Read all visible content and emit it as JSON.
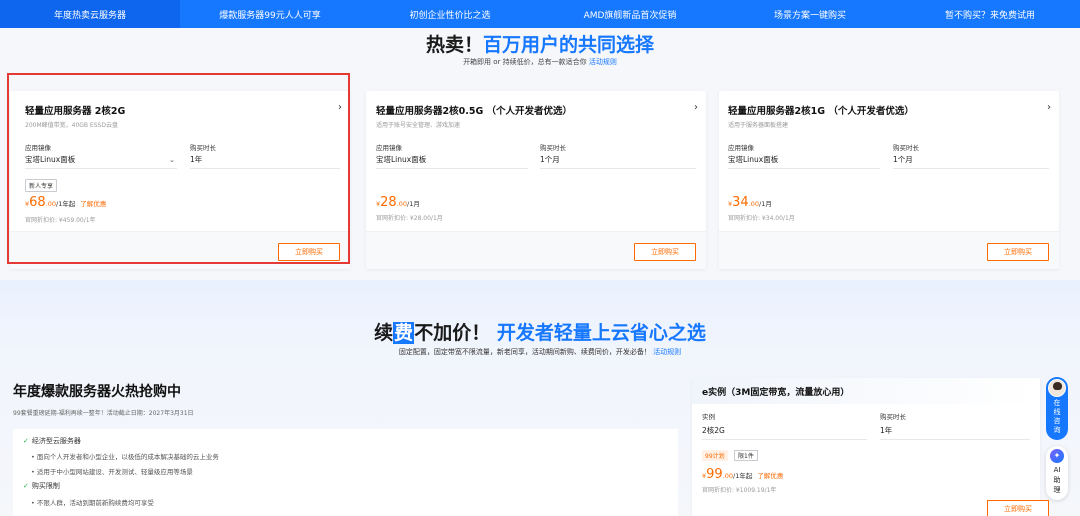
{
  "tabs": [
    "年度热卖云服务器",
    "爆款服务器99元人人可享",
    "初创企业性价比之选",
    "AMD旗舰新品首次促销",
    "场景方案一键购买",
    "暂不购买？来免费试用"
  ],
  "section1": {
    "title_a": "热卖！",
    "title_b": "百万用户的共同选择",
    "subtitle": "开箱即用 or 持续低价，总有一款适合你",
    "rules_link": "活动规则"
  },
  "cards": [
    {
      "title": "轻量应用服务器 2核2G",
      "desc": "200M峰值带宽，40GB ESSD云盘",
      "image_label": "应用镜像",
      "image_value": "宝塔Linux面板",
      "duration_label": "购买时长",
      "duration_value": "1年",
      "badge": "新人专享",
      "currency": "¥",
      "price": "68",
      "price_decimal": ".00",
      "price_unit": "/1年起",
      "promo": "了解优惠",
      "orig": "官网折扣价: ¥459.00/1年",
      "buy": "立即购买"
    },
    {
      "title": "轻量应用服务器2核0.5G （个人开发者优选）",
      "desc": "适用于账号安全管理、游戏加速",
      "image_label": "应用镜像",
      "image_value": "宝塔Linux面板",
      "duration_label": "购买时长",
      "duration_value": "1个月",
      "currency": "¥",
      "price": "28",
      "price_decimal": ".00",
      "price_unit": "/1月",
      "orig": "官网折扣价: ¥28.00/1月",
      "buy": "立即购买"
    },
    {
      "title": "轻量应用服务器2核1G （个人开发者优选）",
      "desc": "适用于服务器面板搭建",
      "image_label": "应用镜像",
      "image_value": "宝塔Linux面板",
      "duration_label": "购买时长",
      "duration_value": "1个月",
      "currency": "¥",
      "price": "34",
      "price_decimal": ".00",
      "price_unit": "/1月",
      "orig": "官网折扣价: ¥34.00/1月",
      "buy": "立即购买"
    }
  ],
  "section2": {
    "title_a": "续",
    "title_hl": "费",
    "title_b": "不加价！",
    "title_c": "开发者轻量上云省心之选",
    "subtitle": "固定配置，固定带宽不限流量，新老同享，活动期间新购、续费同价，开发必备！",
    "rules_link": "活动规则",
    "left_title": "年度爆款服务器火热抢购中",
    "left_sub": "99套餐重磅延期-福利再续一整年！活动截止日期：2027年3月31日",
    "list": {
      "h1": "经济型云服务器",
      "b1": "面向个人开发者和小型企业，以极低的成本解决基础的云上业务",
      "b2": "适用于中小型网站建设、开发测试、轻量级应用等场景",
      "h2": "购买限制",
      "b3": "不限人群，活动到期前新购续费均可享受"
    }
  },
  "ecard": {
    "title": "e实例（3M固定带宽，流量放心用）",
    "inst_label": "实例",
    "inst_value": "2核2G",
    "dur_label": "购买时长",
    "dur_value": "1年",
    "tag1": "99计划",
    "tag2": "限1件",
    "currency": "¥",
    "price": "99",
    "price_decimal": ".00",
    "price_unit": "/1年起",
    "promo": "了解优惠",
    "orig": "官网折扣价: ¥1009.19/1年",
    "buy": "立即购买"
  },
  "float": {
    "consult": [
      "在",
      "线",
      "咨",
      "询"
    ],
    "ai": [
      "AI",
      "助",
      "理"
    ]
  }
}
